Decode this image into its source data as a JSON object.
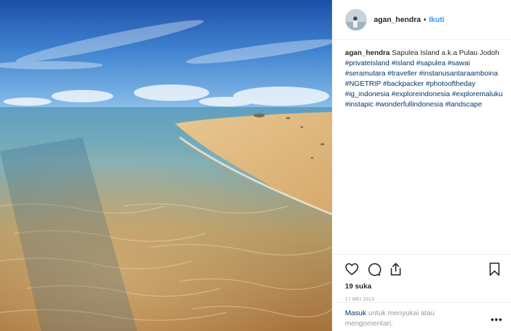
{
  "post": {
    "username": "agan_hendra",
    "separator": "•",
    "follow_label": "Ikuti",
    "caption": {
      "username": "agan_hendra",
      "text": "Sapulea Island a.k.a Pulau Jodoh",
      "hashtags": [
        "#privateisland",
        "#island",
        "#sapulea",
        "#sawai",
        "#seramutara",
        "#traveller",
        "#instanusantaraamboina",
        "#NGETRIP",
        "#backpacker",
        "#photooftheday",
        "#ig_indonesia",
        "#exploreindonesia",
        "#exploremaluku",
        "#instapic",
        "#wonderfullindonesia",
        "#landscape"
      ]
    },
    "likes": "19 suka",
    "date": "17 MEI 2015",
    "login": {
      "link": "Masuk",
      "text": " untuk menyukai atau mengomentari."
    },
    "more_label": "•••"
  },
  "icons": {
    "like": "heart-icon",
    "comment": "comment-icon",
    "share": "share-icon",
    "save": "bookmark-icon",
    "more": "more-options-icon"
  },
  "colors": {
    "link_blue": "#3897f0",
    "hashtag": "#003569",
    "muted": "#999999"
  }
}
